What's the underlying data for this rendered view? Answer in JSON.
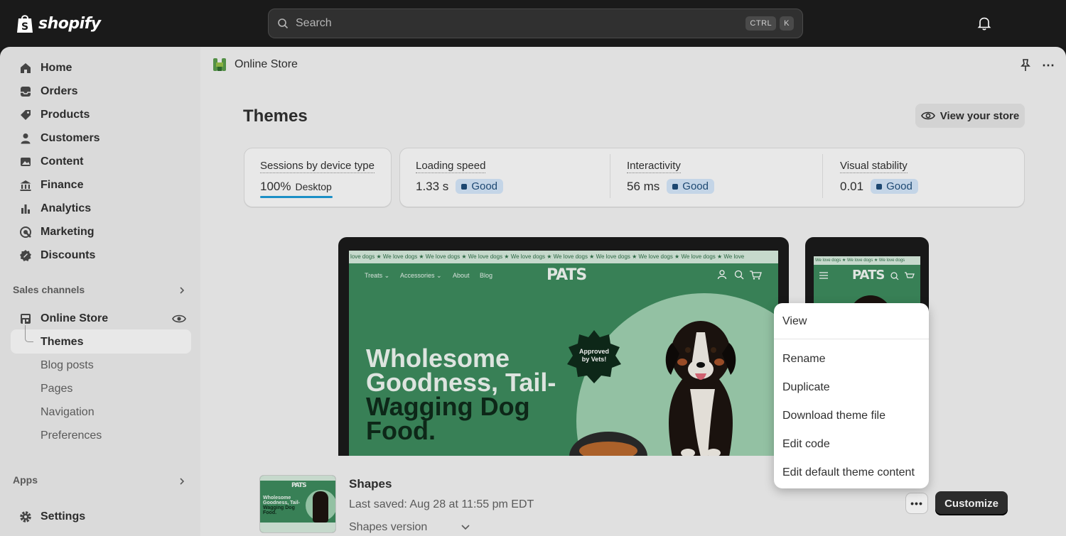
{
  "brand": {
    "name": "shopify"
  },
  "search": {
    "placeholder": "Search",
    "shortcut_ctrl": "CTRL",
    "shortcut_key": "K"
  },
  "sidebar": {
    "items": [
      {
        "label": "Home",
        "icon": "home-icon"
      },
      {
        "label": "Orders",
        "icon": "inbox-icon"
      },
      {
        "label": "Products",
        "icon": "tag-icon"
      },
      {
        "label": "Customers",
        "icon": "person-icon"
      },
      {
        "label": "Content",
        "icon": "image-icon"
      },
      {
        "label": "Finance",
        "icon": "bank-icon"
      },
      {
        "label": "Analytics",
        "icon": "bar-chart-icon"
      },
      {
        "label": "Marketing",
        "icon": "target-icon"
      },
      {
        "label": "Discounts",
        "icon": "discount-icon"
      }
    ],
    "sales_channels_label": "Sales channels",
    "online_store_label": "Online Store",
    "sub_items": [
      "Themes",
      "Blog posts",
      "Pages",
      "Navigation",
      "Preferences"
    ],
    "apps_label": "Apps",
    "settings_label": "Settings"
  },
  "header": {
    "breadcrumb": "Online Store",
    "title": "Themes",
    "view_store": "View your store"
  },
  "metrics": {
    "sessions": {
      "label": "Sessions by device type",
      "percent": "100%",
      "device": "Desktop"
    },
    "loading": {
      "label": "Loading speed",
      "value": "1.33 s",
      "status": "Good"
    },
    "interactivity": {
      "label": "Interactivity",
      "value": "56 ms",
      "status": "Good"
    },
    "stability": {
      "label": "Visual stability",
      "value": "0.01",
      "status": "Good"
    }
  },
  "preview": {
    "marquee": "love dogs ★ We love dogs ★ We love dogs ★ We love dogs ★ We love dogs ★ We love dogs ★ We love dogs ★ We love dogs ★ We love dogs ★ We love",
    "phone_marquee": "We love dogs ★ We love dogs ★ We love dogs",
    "nav_treats": "Treats ⌄",
    "nav_accessories": "Accessories ⌄",
    "nav_about": "About",
    "nav_blog": "Blog",
    "brand": "PATS",
    "hero_line1": "Wholesome",
    "hero_line2": "Goodness, Tail-",
    "hero_line3": "Wagging Dog",
    "hero_line4": "Food.",
    "seal_line1": "Approved",
    "seal_line2": "by Vets!"
  },
  "theme": {
    "name": "Shapes",
    "last_saved": "Last saved: Aug 28 at 11:55 pm EDT",
    "version": "Shapes version",
    "more": "•••",
    "customize": "Customize"
  },
  "menu": {
    "items": [
      "View",
      "Rename",
      "Duplicate",
      "Download theme file",
      "Edit code",
      "Edit default theme content"
    ]
  },
  "colors": {
    "accent": "#3d8a5d",
    "primary_button": "#303030",
    "badge_bg": "#d3e6f9"
  }
}
